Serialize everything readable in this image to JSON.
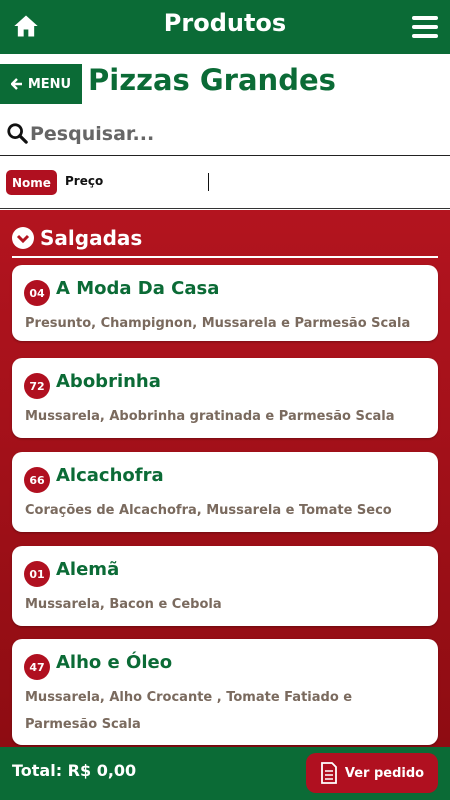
{
  "header": {
    "title": "Produtos",
    "home_icon": "home-icon",
    "menu_icon": "hamburger-icon"
  },
  "subheader": {
    "menu_label": "MENU",
    "page_title": "Pizzas Grandes"
  },
  "search": {
    "placeholder": "Pesquisar..."
  },
  "sort": {
    "active": "Nome",
    "other": "Preço"
  },
  "category": {
    "title": "Salgadas"
  },
  "products": [
    {
      "num": "04",
      "name": "A Moda Da Casa",
      "desc": "Presunto, Champignon, Mussarela e Parmesão Scala"
    },
    {
      "num": "72",
      "name": "Abobrinha",
      "desc": "Mussarela, Abobrinha gratinada e Parmesão Scala"
    },
    {
      "num": "66",
      "name": "Alcachofra",
      "desc": "Corações de Alcachofra, Mussarela e Tomate Seco"
    },
    {
      "num": "01",
      "name": "Alemã",
      "desc": "Mussarela, Bacon e Cebola"
    },
    {
      "num": "47",
      "name": "Alho e Óleo",
      "desc": "Mussarela, Alho Crocante , Tomate Fatiado e Parmesão Scala"
    }
  ],
  "footer": {
    "total": "Total: R$ 0,00",
    "order_button": "Ver pedido"
  },
  "colors": {
    "green": "#0b6b36",
    "red": "#b01020"
  }
}
